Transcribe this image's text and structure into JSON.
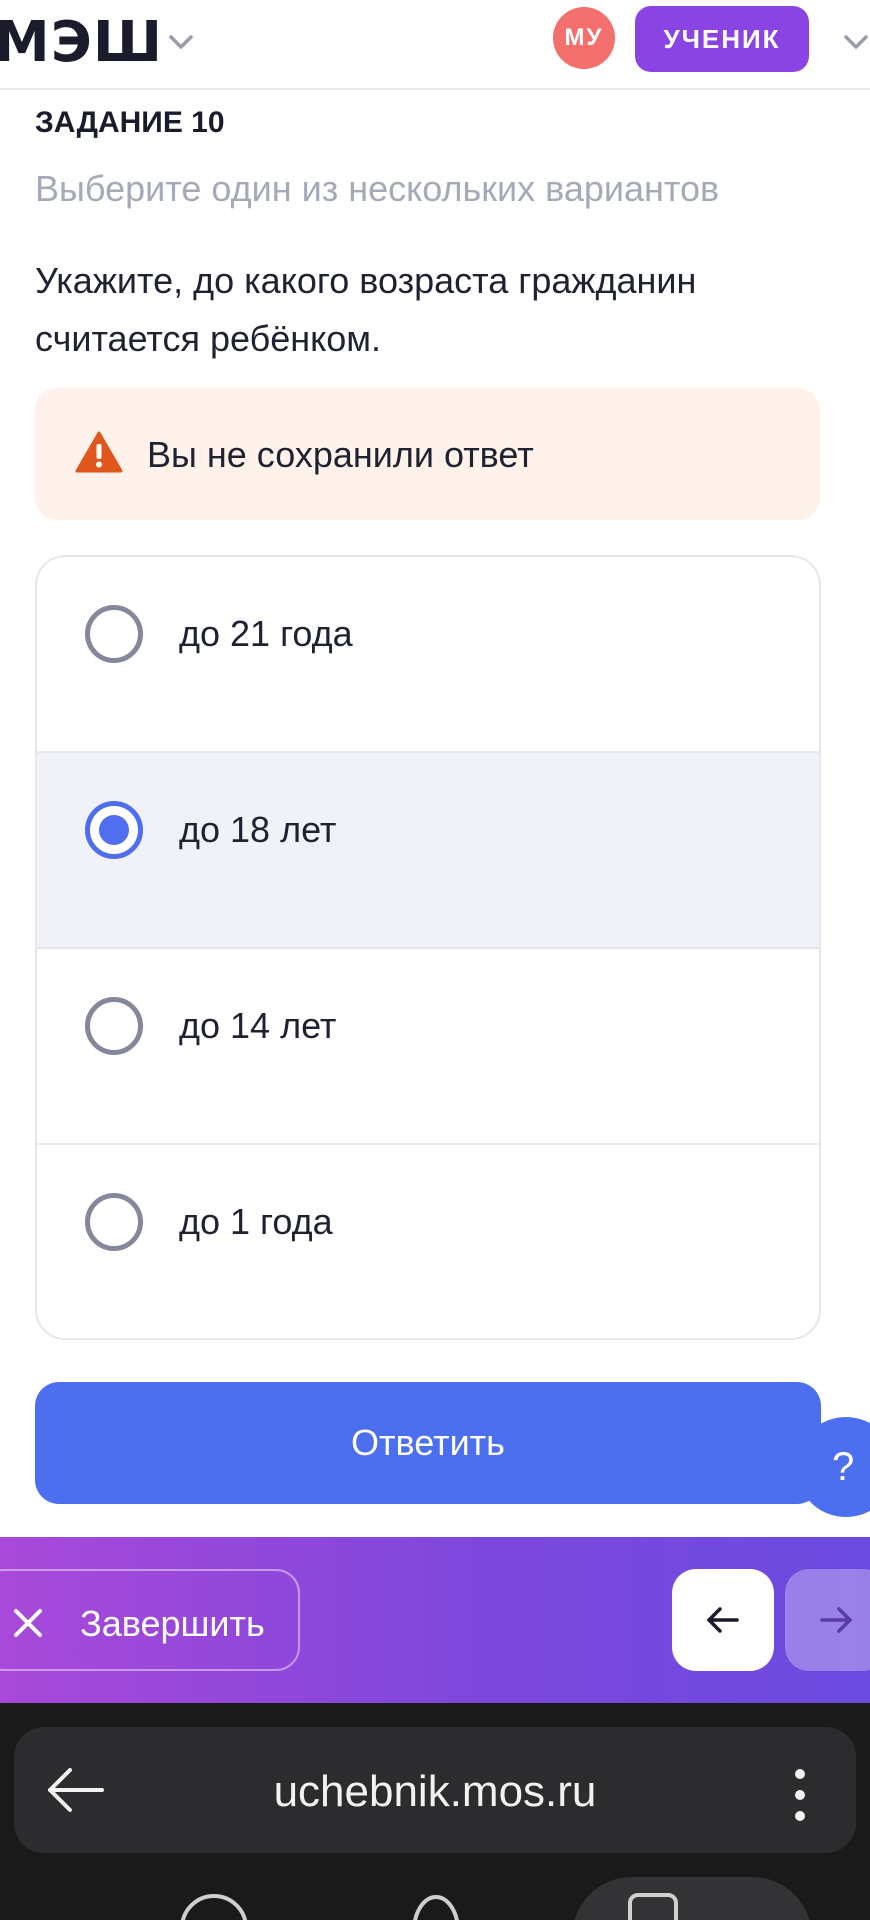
{
  "header": {
    "logo": "МЭШ",
    "avatar_initials": "МУ",
    "role": "УЧЕНИК",
    "colors": {
      "avatar": "#f3706e",
      "role": "#8b44e4"
    }
  },
  "task": {
    "number": "ЗАДАНИЕ 10",
    "hint": "Выберите один из нескольких вариантов",
    "question": "Укажите, до какого возраста гражданин считается ребёнком."
  },
  "warning": {
    "icon": "warning-triangle-icon",
    "text": "Вы не сохранили ответ",
    "color": "#e0561c"
  },
  "options": [
    {
      "label": "до 21 года",
      "selected": false
    },
    {
      "label": "до 18 лет",
      "selected": true
    },
    {
      "label": "до 14 лет",
      "selected": false
    },
    {
      "label": "до 1 года",
      "selected": false
    }
  ],
  "submit_label": "Ответить",
  "help_label": "?",
  "footer": {
    "finish_label": "Завершить",
    "prev_icon": "arrow-left-icon",
    "next_icon": "arrow-right-icon"
  },
  "browser": {
    "url": "uchebnik.mos.ru",
    "back_icon": "arrow-left-icon",
    "menu_icon": "more-vertical-icon"
  },
  "accent_color": "#4c6ff0"
}
